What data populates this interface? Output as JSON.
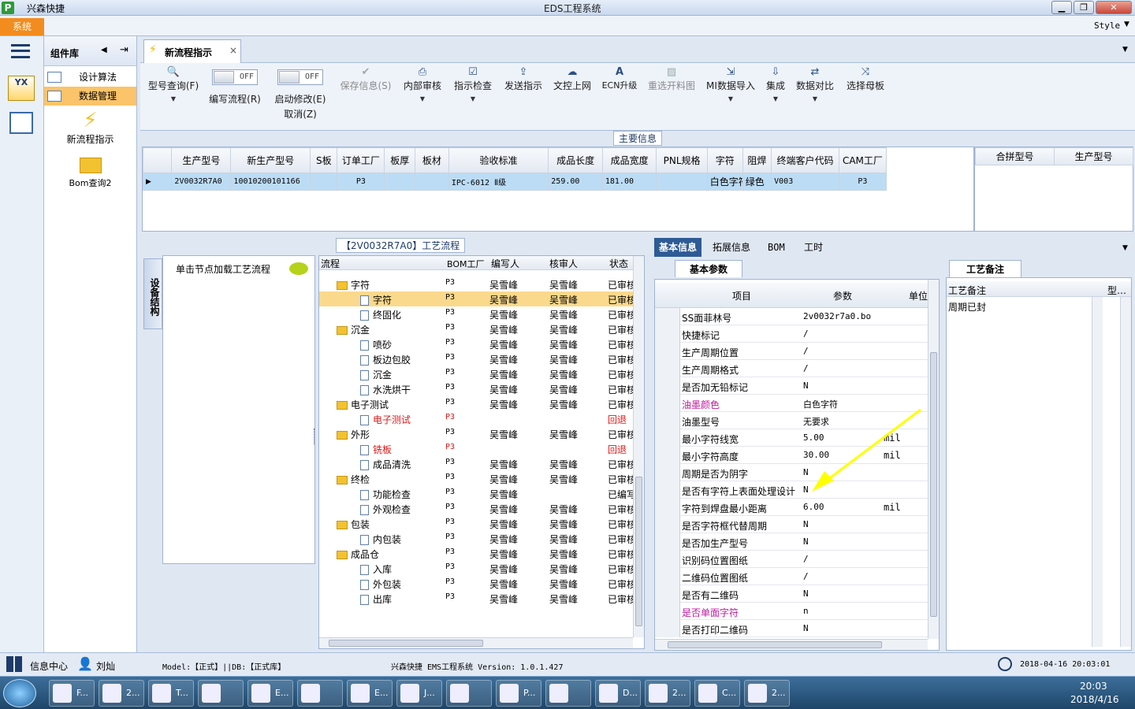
{
  "window": {
    "title": "EDS工程系统",
    "app_name": "兴森快捷",
    "style_label": "Style"
  },
  "menu": {
    "system": "系统"
  },
  "component_panel": {
    "title": "组件库",
    "items": [
      {
        "label": "设计算法"
      },
      {
        "label": "数据管理"
      }
    ],
    "launchers": [
      {
        "label": "新流程指示"
      },
      {
        "label": "Bom查询2"
      }
    ]
  },
  "doc_tab": {
    "label": "新流程指示",
    "close": "×"
  },
  "ribbon": {
    "buttons": [
      {
        "label": "型号查询(F)",
        "icon": "search-icon"
      },
      {
        "label": "编写流程(R)",
        "toggle": "OFF"
      },
      {
        "label": "启动修改(E)",
        "label2": "取消(Z)",
        "toggle": "OFF"
      },
      {
        "label": "保存信息(S)",
        "icon": "check-icon",
        "disabled": true
      },
      {
        "label": "内部审核",
        "icon": "printer-icon"
      },
      {
        "label": "指示检查",
        "icon": "check-icon"
      },
      {
        "label": "发送指示",
        "icon": "upload-icon"
      },
      {
        "label": "文控上网",
        "icon": "cloud-upload-icon"
      },
      {
        "label": "ECN升级",
        "icon": "letter-a-icon"
      },
      {
        "label": "重选开料图",
        "icon": "image-icon",
        "disabled": true
      },
      {
        "label": "MI数据导入",
        "icon": "import-icon"
      },
      {
        "label": "集成",
        "icon": "download-icon"
      },
      {
        "label": "数据对比",
        "icon": "compare-icon"
      },
      {
        "label": "选择母板",
        "icon": "shuffle-icon"
      }
    ]
  },
  "main_info": {
    "title": "主要信息",
    "columns": [
      "生产型号",
      "新生产型号",
      "S板",
      "订单工厂",
      "板厚",
      "板材",
      "验收标准",
      "成品长度",
      "成品宽度",
      "PNL规格",
      "字符",
      "阻焊",
      "终端客户代码",
      "CAM工厂"
    ],
    "row": [
      "2V0032R7A0",
      "10010200101166",
      "",
      "P3",
      "",
      "",
      "IPC-6012 Ⅱ级",
      "259.00",
      "181.00",
      "",
      "白色字符",
      "绿色",
      "V003",
      "P3"
    ],
    "side_columns": [
      "合拼型号",
      "生产型号"
    ]
  },
  "process": {
    "title": "【2V0032R7A0】工艺流程",
    "vertical_tab": "设备结构",
    "hint": "单击节点加载工艺流程",
    "columns": [
      "流程",
      "BOM工厂",
      "编写人",
      "核审人",
      "状态"
    ],
    "rows": [
      {
        "name": "字符",
        "level": 0,
        "type": "folder",
        "bom": "P3",
        "writer": "吴雪峰",
        "reviewer": "吴雪峰",
        "status": "已审核"
      },
      {
        "name": "字符",
        "level": 1,
        "type": "doc",
        "bom": "P3",
        "writer": "吴雪峰",
        "reviewer": "吴雪峰",
        "status": "已审核",
        "selected": true
      },
      {
        "name": "终固化",
        "level": 1,
        "type": "doc",
        "bom": "P3",
        "writer": "吴雪峰",
        "reviewer": "吴雪峰",
        "status": "已审核"
      },
      {
        "name": "沉金",
        "level": 0,
        "type": "folder",
        "bom": "P3",
        "writer": "吴雪峰",
        "reviewer": "吴雪峰",
        "status": "已审核"
      },
      {
        "name": "喷砂",
        "level": 1,
        "type": "doc",
        "bom": "P3",
        "writer": "吴雪峰",
        "reviewer": "吴雪峰",
        "status": "已审核"
      },
      {
        "name": "板边包胶",
        "level": 1,
        "type": "doc",
        "bom": "P3",
        "writer": "吴雪峰",
        "reviewer": "吴雪峰",
        "status": "已审核"
      },
      {
        "name": "沉金",
        "level": 1,
        "type": "doc",
        "bom": "P3",
        "writer": "吴雪峰",
        "reviewer": "吴雪峰",
        "status": "已审核"
      },
      {
        "name": "水洗烘干",
        "level": 1,
        "type": "doc",
        "bom": "P3",
        "writer": "吴雪峰",
        "reviewer": "吴雪峰",
        "status": "已审核"
      },
      {
        "name": "电子测试",
        "level": 0,
        "type": "folder",
        "bom": "P3",
        "writer": "吴雪峰",
        "reviewer": "吴雪峰",
        "status": "已审核"
      },
      {
        "name": "电子测试",
        "level": 1,
        "type": "doc",
        "bom": "P3",
        "writer": "",
        "reviewer": "",
        "status": "回退",
        "red": true
      },
      {
        "name": "外形",
        "level": 0,
        "type": "folder",
        "bom": "P3",
        "writer": "吴雪峰",
        "reviewer": "吴雪峰",
        "status": "已审核"
      },
      {
        "name": "铣板",
        "level": 1,
        "type": "doc",
        "bom": "P3",
        "writer": "",
        "reviewer": "",
        "status": "回退",
        "red": true
      },
      {
        "name": "成品清洗",
        "level": 1,
        "type": "doc",
        "bom": "P3",
        "writer": "吴雪峰",
        "reviewer": "吴雪峰",
        "status": "已审核"
      },
      {
        "name": "终检",
        "level": 0,
        "type": "folder",
        "bom": "P3",
        "writer": "吴雪峰",
        "reviewer": "吴雪峰",
        "status": "已审核"
      },
      {
        "name": "功能检查",
        "level": 1,
        "type": "doc",
        "bom": "P3",
        "writer": "吴雪峰",
        "reviewer": "",
        "status": "已编写"
      },
      {
        "name": "外观检查",
        "level": 1,
        "type": "doc",
        "bom": "P3",
        "writer": "吴雪峰",
        "reviewer": "吴雪峰",
        "status": "已审核"
      },
      {
        "name": "包装",
        "level": 0,
        "type": "folder",
        "bom": "P3",
        "writer": "吴雪峰",
        "reviewer": "吴雪峰",
        "status": "已审核"
      },
      {
        "name": "内包装",
        "level": 1,
        "type": "doc",
        "bom": "P3",
        "writer": "吴雪峰",
        "reviewer": "吴雪峰",
        "status": "已审核"
      },
      {
        "name": "成品仓",
        "level": 0,
        "type": "folder",
        "bom": "P3",
        "writer": "吴雪峰",
        "reviewer": "吴雪峰",
        "status": "已审核"
      },
      {
        "name": "入库",
        "level": 1,
        "type": "doc",
        "bom": "P3",
        "writer": "吴雪峰",
        "reviewer": "吴雪峰",
        "status": "已审核"
      },
      {
        "name": "外包装",
        "level": 1,
        "type": "doc",
        "bom": "P3",
        "writer": "吴雪峰",
        "reviewer": "吴雪峰",
        "status": "已审核"
      },
      {
        "name": "出库",
        "level": 1,
        "type": "doc",
        "bom": "P3",
        "writer": "吴雪峰",
        "reviewer": "吴雪峰",
        "status": "已审核"
      }
    ]
  },
  "detail": {
    "tabs": [
      "基本信息",
      "拓展信息",
      "BOM",
      "工时"
    ],
    "sub_tab": "基本参数",
    "columns": [
      "项目",
      "参数",
      "单位"
    ],
    "rows": [
      {
        "item": "SS面菲林号",
        "value": "2v0032r7a0.bo",
        "unit": ""
      },
      {
        "item": "快捷标记",
        "value": "/",
        "unit": ""
      },
      {
        "item": "生产周期位置",
        "value": "/",
        "unit": ""
      },
      {
        "item": "生产周期格式",
        "value": "/",
        "unit": ""
      },
      {
        "item": "是否加无铅标记",
        "value": "N",
        "unit": ""
      },
      {
        "item": "油墨颜色",
        "value": "白色字符",
        "unit": "",
        "pink": true
      },
      {
        "item": "油墨型号",
        "value": "无要求",
        "unit": ""
      },
      {
        "item": "最小字符线宽",
        "value": "5.00",
        "unit": "mil"
      },
      {
        "item": "最小字符高度",
        "value": "30.00",
        "unit": "mil"
      },
      {
        "item": "周期是否为阴字",
        "value": "N",
        "unit": ""
      },
      {
        "item": "是否有字符上表面处理设计",
        "value": "N",
        "unit": ""
      },
      {
        "item": "字符到焊盘最小距离",
        "value": "6.00",
        "unit": "mil"
      },
      {
        "item": "是否字符框代替周期",
        "value": "N",
        "unit": ""
      },
      {
        "item": "是否加生产型号",
        "value": "N",
        "unit": ""
      },
      {
        "item": "识别码位置图纸",
        "value": "/",
        "unit": ""
      },
      {
        "item": "二维码位置图纸",
        "value": "/",
        "unit": ""
      },
      {
        "item": "是否有二维码",
        "value": "N",
        "unit": ""
      },
      {
        "item": "是否单面字符",
        "value": "n",
        "unit": "",
        "pink": true
      },
      {
        "item": "是否打印二维码",
        "value": "N",
        "unit": ""
      }
    ]
  },
  "remark": {
    "title": "工艺备注",
    "col1": "工艺备注",
    "col2": "型…",
    "value": "周期已封"
  },
  "status": {
    "info_center": "信息中心",
    "user": "刘灿",
    "model_db": "Model:【正式】||DB:【正式库】",
    "version": "兴森快捷 EMS工程系统 Version: 1.0.1.427",
    "datetime": "2018-04-16 20:03:01"
  },
  "taskbar": {
    "clock_time": "20:03",
    "clock_date": "2018/4/16",
    "buttons": [
      "F...",
      "2...",
      "T...",
      "",
      "E...",
      "",
      "E...",
      "J...",
      "",
      "P...",
      "",
      "D...",
      "2...",
      "C...",
      "2..."
    ]
  },
  "colors": {
    "accent": "#f28c1e",
    "selection": "#bcdcf5",
    "highlight_row": "#fbd98c",
    "red": "#e01818",
    "pink": "#c0189e",
    "arrow": "#ffff00"
  }
}
